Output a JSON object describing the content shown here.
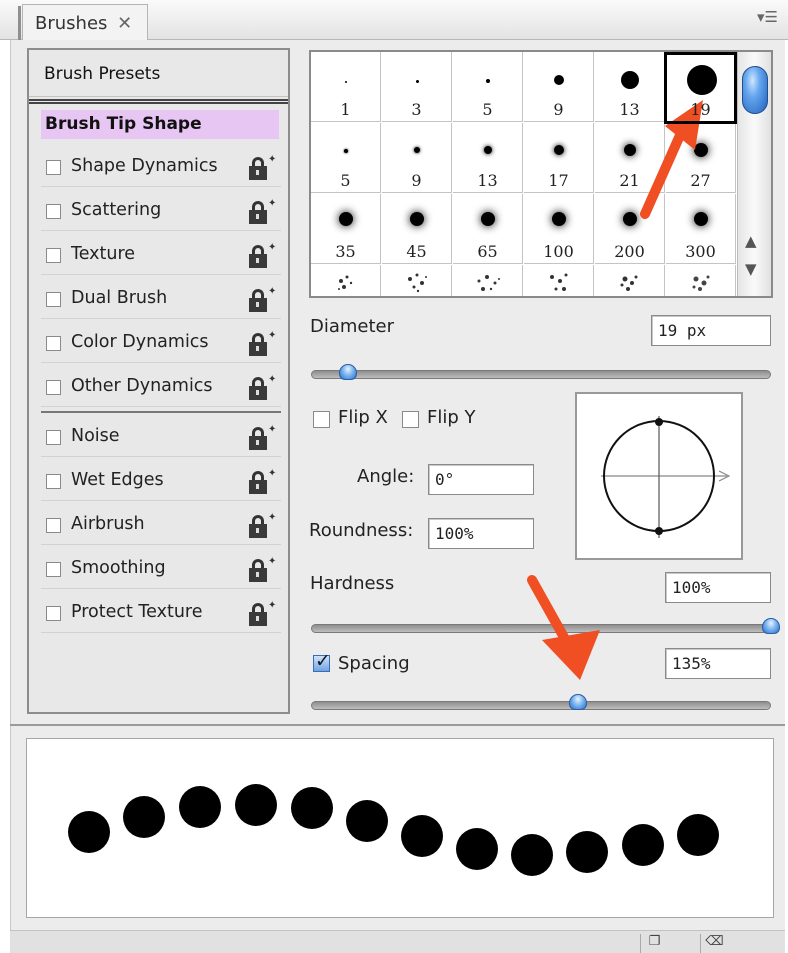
{
  "tab": {
    "label": "Brushes",
    "close": "✕",
    "menu_icon": "panel-menu-icon"
  },
  "sidebar": {
    "presets_label": "Brush Presets",
    "tip_shape_label": "Brush Tip Shape",
    "tip_shape_highlight": "#e7c6f3",
    "group1": [
      {
        "label": "Shape Dynamics",
        "checked": false
      },
      {
        "label": "Scattering",
        "checked": false
      },
      {
        "label": "Texture",
        "checked": false
      },
      {
        "label": "Dual Brush",
        "checked": false
      },
      {
        "label": "Color Dynamics",
        "checked": false
      },
      {
        "label": "Other Dynamics",
        "checked": false
      }
    ],
    "group2": [
      {
        "label": "Noise",
        "checked": false
      },
      {
        "label": "Wet Edges",
        "checked": false
      },
      {
        "label": "Airbrush",
        "checked": false
      },
      {
        "label": "Smoothing",
        "checked": false
      },
      {
        "label": "Protect Texture",
        "checked": false
      }
    ]
  },
  "brush_grid": {
    "rows": [
      [
        "1",
        "3",
        "5",
        "9",
        "13",
        "19"
      ],
      [
        "5",
        "9",
        "13",
        "17",
        "21",
        "27"
      ],
      [
        "35",
        "45",
        "65",
        "100",
        "200",
        "300"
      ],
      [
        "",
        "",
        "",
        "",
        "",
        ""
      ]
    ],
    "selected": "19"
  },
  "diameter": {
    "label": "Diameter",
    "value": "19 px",
    "slider_fraction": 0.08
  },
  "flip_x": {
    "label": "Flip X",
    "checked": false
  },
  "flip_y": {
    "label": "Flip Y",
    "checked": false
  },
  "angle": {
    "label": "Angle:",
    "value": "0°"
  },
  "roundness": {
    "label": "Roundness:",
    "value": "100%"
  },
  "hardness": {
    "label": "Hardness",
    "value": "100%",
    "slider_fraction": 1.0
  },
  "spacing": {
    "label": "Spacing",
    "value": "135%",
    "checked": true,
    "slider_fraction": 0.58
  },
  "annotation_color": "#f04e23",
  "preview_stroke": "wavy dotted stroke of 12 round dabs"
}
